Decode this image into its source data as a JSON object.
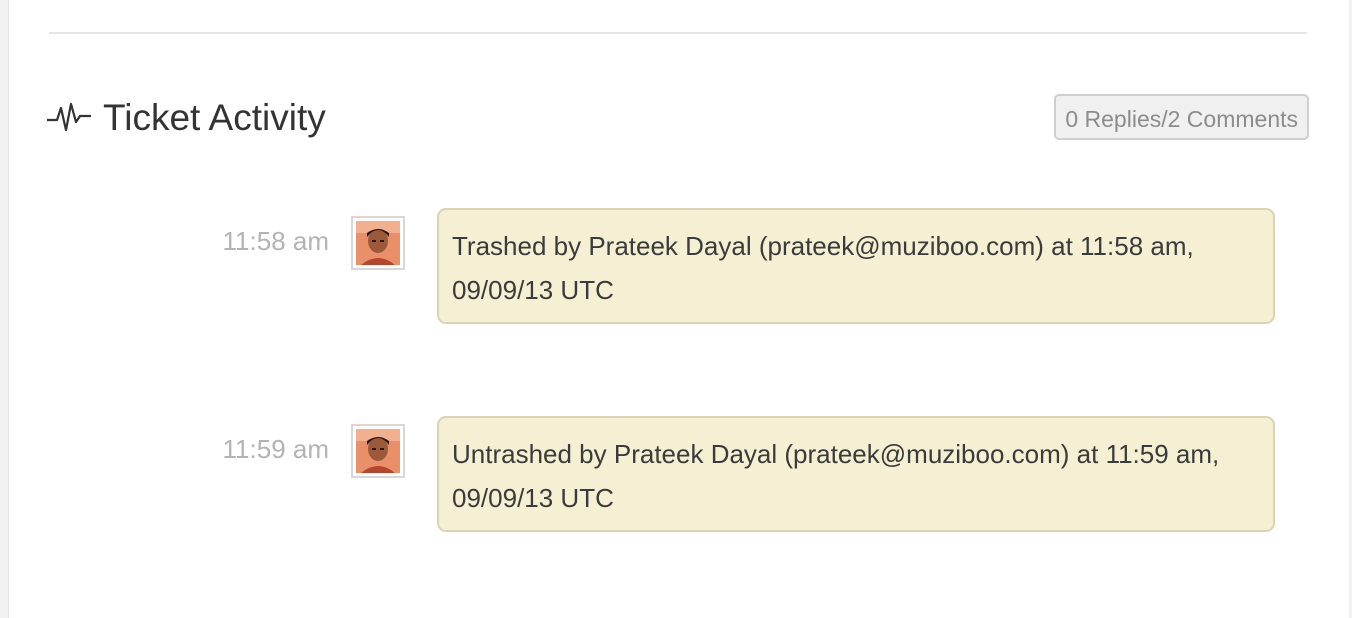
{
  "section": {
    "title": "Ticket Activity",
    "icon": "activity-pulse-icon",
    "count_badge": "0 Replies/2 Comments"
  },
  "activities": [
    {
      "time": "11:58 am",
      "avatar": "user-avatar",
      "message": "Trashed by Prateek Dayal (prateek@muziboo.com) at 11:58 am, 09/09/13 UTC"
    },
    {
      "time": "11:59 am",
      "avatar": "user-avatar",
      "message": "Untrashed by Prateek Dayal (prateek@muziboo.com) at 11:59 am, 09/09/13 UTC"
    }
  ],
  "colors": {
    "bubble_background": "#f5f0d3",
    "bubble_border": "#d9d4b4",
    "muted_text": "#b3b3b3"
  }
}
